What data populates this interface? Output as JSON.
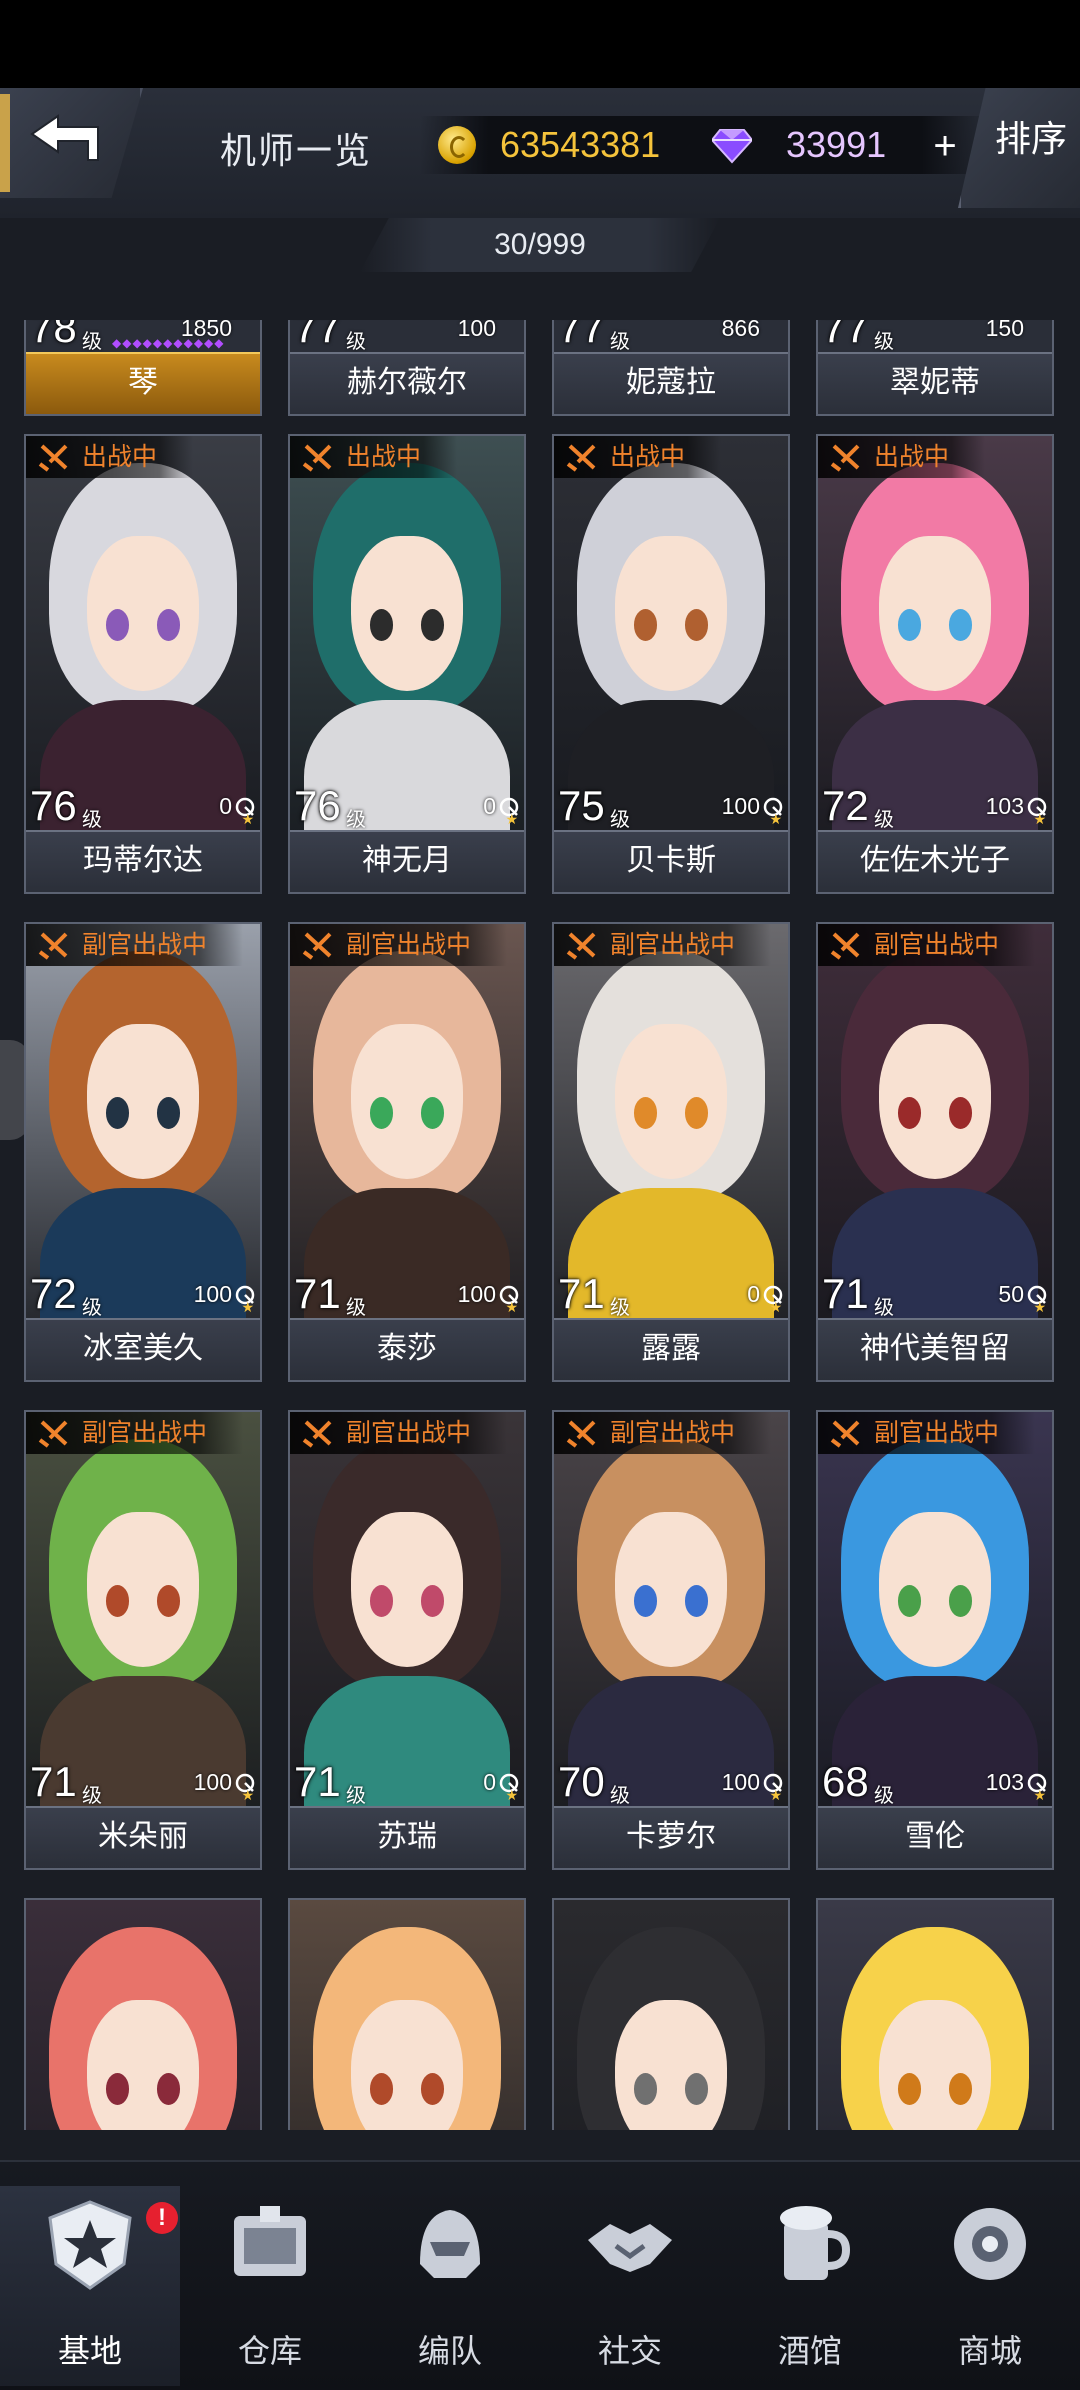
{
  "header": {
    "title": "机师一览",
    "gold": "63543381",
    "diamond": "33991",
    "plus": "+",
    "sort_label": "排序"
  },
  "count": "30/999",
  "level_unit": "级",
  "top_row": [
    {
      "level": "78",
      "stat": "1850",
      "name": "琴",
      "gold": true
    },
    {
      "level": "77",
      "stat": "100",
      "name": "赫尔薇尔"
    },
    {
      "level": "77",
      "stat": "866",
      "name": "妮蔻拉"
    },
    {
      "level": "77",
      "stat": "150",
      "name": "翠妮蒂"
    }
  ],
  "rows": [
    [
      {
        "status": "出战中",
        "level": "76",
        "stat": "0",
        "name": "玛蒂尔达",
        "palette": {
          "bg": "#3a3d45",
          "hair": "#d8d8de",
          "eye": "#8a5ab8",
          "body": "#3b2230"
        }
      },
      {
        "status": "出战中",
        "level": "76",
        "stat": "0",
        "name": "神无月",
        "palette": {
          "bg": "#3e4f52",
          "hair": "#1f6e6a",
          "eye": "#2c2c2c",
          "body": "#d9d9dc"
        }
      },
      {
        "status": "出战中",
        "level": "75",
        "stat": "100",
        "name": "贝卡斯",
        "palette": {
          "bg": "#2d2f36",
          "hair": "#cfd0d8",
          "eye": "#b06030",
          "body": "#1e1f24"
        }
      },
      {
        "status": "出战中",
        "level": "72",
        "stat": "103",
        "name": "佐佐木光子",
        "palette": {
          "bg": "#4a3a48",
          "hair": "#f27aa5",
          "eye": "#4aa8e0",
          "body": "#3c2f45"
        }
      }
    ],
    [
      {
        "status": "副官出战中",
        "level": "72",
        "stat": "100",
        "name": "冰室美久",
        "palette": {
          "bg": "#9aa0ab",
          "hair": "#b4642e",
          "eye": "#223344",
          "body": "#1b3a5a"
        }
      },
      {
        "status": "副官出战中",
        "level": "71",
        "stat": "100",
        "name": "泰莎",
        "palette": {
          "bg": "#6a5650",
          "hair": "#e7b79b",
          "eye": "#3aa85a",
          "body": "#3a2a25"
        }
      },
      {
        "status": "副官出战中",
        "level": "71",
        "stat": "0",
        "name": "露露",
        "palette": {
          "bg": "#6b6a6e",
          "hair": "#e4e0dc",
          "eye": "#e08a2a",
          "body": "#e3b82a"
        }
      },
      {
        "status": "副官出战中",
        "level": "71",
        "stat": "50",
        "name": "神代美智留",
        "palette": {
          "bg": "#3f2d3a",
          "hair": "#4a2a3a",
          "eye": "#9a2a2a",
          "body": "#2a3050"
        }
      }
    ],
    [
      {
        "status": "副官出战中",
        "level": "71",
        "stat": "100",
        "name": "米朵丽",
        "palette": {
          "bg": "#4a5040",
          "hair": "#6fb24a",
          "eye": "#b04a2a",
          "body": "#4a3a30"
        }
      },
      {
        "status": "副官出战中",
        "level": "71",
        "stat": "0",
        "name": "苏瑞",
        "palette": {
          "bg": "#3a3438",
          "hair": "#3a2a2a",
          "eye": "#c04a6a",
          "body": "#2f8a7e"
        }
      },
      {
        "status": "副官出战中",
        "level": "70",
        "stat": "100",
        "name": "卡萝尔",
        "palette": {
          "bg": "#4a4448",
          "hair": "#c89060",
          "eye": "#3a70d0",
          "body": "#2b2a40"
        }
      },
      {
        "status": "副官出战中",
        "level": "68",
        "stat": "103",
        "name": "雪伦",
        "palette": {
          "bg": "#3a3550",
          "hair": "#3a98e0",
          "eye": "#4aa04a",
          "body": "#2a2238"
        }
      }
    ],
    [
      {
        "palette": {
          "bg": "#3a2e3a",
          "hair": "#e8736a",
          "eye": "#8a2a3a",
          "body": "#2a2240"
        }
      },
      {
        "palette": {
          "bg": "#5a4a40",
          "hair": "#f3b77a",
          "eye": "#b04a2a",
          "body": "#4a3a30"
        }
      },
      {
        "palette": {
          "bg": "#2a2a2e",
          "hair": "#2e2e32",
          "eye": "#707070",
          "body": "#1e1e22"
        }
      },
      {
        "palette": {
          "bg": "#3a3a48",
          "hair": "#f7d24a",
          "eye": "#d07a1a",
          "body": "#2a2a38"
        }
      }
    ]
  ],
  "nav": [
    {
      "label": "基地",
      "icon": "base-star-icon",
      "active": true,
      "badge": "!"
    },
    {
      "label": "仓库",
      "icon": "warehouse-icon"
    },
    {
      "label": "编队",
      "icon": "formation-helmet-icon"
    },
    {
      "label": "社交",
      "icon": "handshake-icon"
    },
    {
      "label": "酒馆",
      "icon": "tavern-mug-icon"
    },
    {
      "label": "商城",
      "icon": "shop-orb-icon"
    }
  ]
}
